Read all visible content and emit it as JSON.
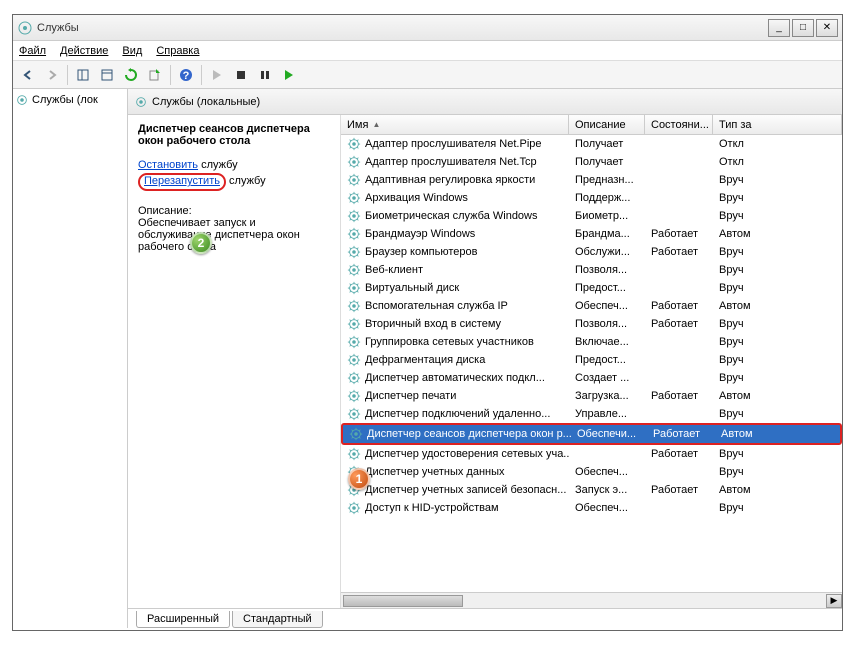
{
  "title": "Службы",
  "menus": {
    "file": "Файл",
    "action": "Действие",
    "view": "Вид",
    "help": "Справка"
  },
  "leftTree": "Службы (лок",
  "rightTitle": "Службы (локальные)",
  "detail": {
    "title": "Диспетчер сеансов диспетчера окон рабочего стола",
    "stop": "Остановить",
    "stopSuffix": " службу",
    "restart": "Перезапустить",
    "restartSuffix": " службу",
    "descLabel": "Описание:",
    "desc": "Обеспечивает запуск и обслуживание диспетчера окон рабочего стола"
  },
  "columns": {
    "name": "Имя",
    "desc": "Описание",
    "state": "Состояни...",
    "type": "Тип за"
  },
  "tabs": {
    "ext": "Расширенный",
    "std": "Стандартный"
  },
  "rows": [
    {
      "n": "Адаптер прослушивателя Net.Pipe",
      "d": "Получает",
      "s": "",
      "t": "Откл"
    },
    {
      "n": "Адаптер прослушивателя Net.Tcp",
      "d": "Получает",
      "s": "",
      "t": "Откл"
    },
    {
      "n": "Адаптивная регулировка яркости",
      "d": "Предназн...",
      "s": "",
      "t": "Вруч"
    },
    {
      "n": "Архивация Windows",
      "d": "Поддерж...",
      "s": "",
      "t": "Вруч"
    },
    {
      "n": "Биометрическая служба Windows",
      "d": "Биометр...",
      "s": "",
      "t": "Вруч"
    },
    {
      "n": "Брандмауэр Windows",
      "d": "Брандма...",
      "s": "Работает",
      "t": "Автом"
    },
    {
      "n": "Браузер компьютеров",
      "d": "Обслужи...",
      "s": "Работает",
      "t": "Вруч"
    },
    {
      "n": "Веб-клиент",
      "d": "Позволя...",
      "s": "",
      "t": "Вруч"
    },
    {
      "n": "Виртуальный диск",
      "d": "Предост...",
      "s": "",
      "t": "Вруч"
    },
    {
      "n": "Вспомогательная служба IP",
      "d": "Обеспеч...",
      "s": "Работает",
      "t": "Автом"
    },
    {
      "n": "Вторичный вход в систему",
      "d": "Позволя...",
      "s": "Работает",
      "t": "Вруч"
    },
    {
      "n": "Группировка сетевых участников",
      "d": "Включае...",
      "s": "",
      "t": "Вруч"
    },
    {
      "n": "Дефрагментация диска",
      "d": "Предост...",
      "s": "",
      "t": "Вруч"
    },
    {
      "n": "Диспетчер автоматических подкл...",
      "d": "Создает ...",
      "s": "",
      "t": "Вруч"
    },
    {
      "n": "Диспетчер печати",
      "d": "Загрузка...",
      "s": "Работает",
      "t": "Автом"
    },
    {
      "n": "Диспетчер подключений удаленно...",
      "d": "Управле...",
      "s": "",
      "t": "Вруч"
    },
    {
      "n": "Диспетчер сеансов диспетчера окон р...",
      "d": "Обеспечи...",
      "s": "Работает",
      "t": "Автом",
      "sel": true
    },
    {
      "n": "Диспетчер удостоверения сетевых уча...",
      "d": "",
      "s": "Работает",
      "t": "Вруч"
    },
    {
      "n": "Диспетчер учетных данных",
      "d": "Обеспеч...",
      "s": "",
      "t": "Вруч"
    },
    {
      "n": "Диспетчер учетных записей безопасн...",
      "d": "Запуск э...",
      "s": "Работает",
      "t": "Автом"
    },
    {
      "n": "Доступ к HID-устройствам",
      "d": "Обеспеч...",
      "s": "",
      "t": "Вруч"
    }
  ]
}
